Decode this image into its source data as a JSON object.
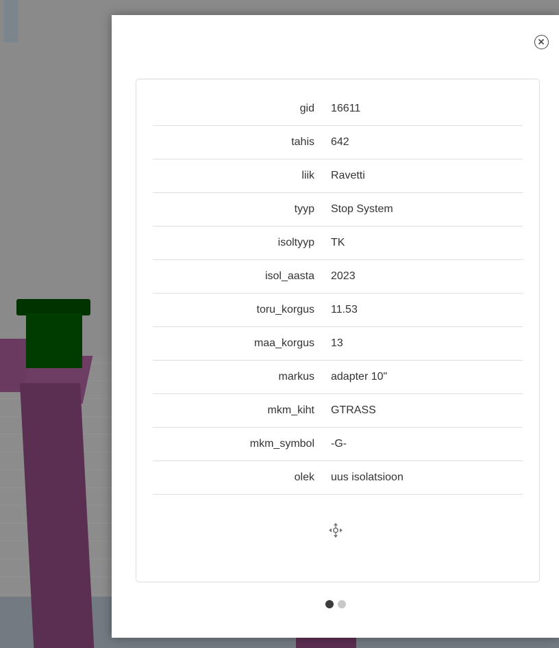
{
  "popup": {
    "attributes": [
      {
        "key": "gid",
        "value": "16611"
      },
      {
        "key": "tahis",
        "value": "642"
      },
      {
        "key": "liik",
        "value": "Ravetti"
      },
      {
        "key": "tyyp",
        "value": "Stop System"
      },
      {
        "key": "isoltyyp",
        "value": "TK"
      },
      {
        "key": "isol_aasta",
        "value": "2023"
      },
      {
        "key": "toru_korgus",
        "value": "11.53"
      },
      {
        "key": "maa_korgus",
        "value": "13"
      },
      {
        "key": "markus",
        "value": "adapter 10\""
      },
      {
        "key": "mkm_kiht",
        "value": "GTRASS"
      },
      {
        "key": "mkm_symbol",
        "value": "-G-"
      },
      {
        "key": "olek",
        "value": "uus isolatsioon"
      }
    ],
    "pager": {
      "count": 2,
      "active": 1
    },
    "icons": {
      "close": "close-circle-icon",
      "move": "move-arrows-icon"
    }
  },
  "colors": {
    "pipe": "#5b2f51",
    "cap": "#003b00",
    "scene_bg": "#8a8a8a"
  }
}
